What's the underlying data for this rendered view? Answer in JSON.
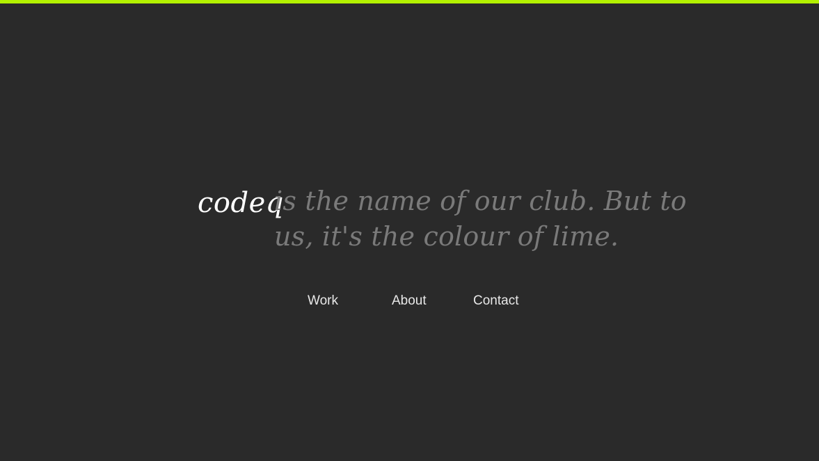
{
  "colors": {
    "background": "#2a2a2a",
    "accent_bar": "#b3f000",
    "brand_text": "#ffffff",
    "tagline_text": "#7a7a7a",
    "nav_text": "#e8e8e8"
  },
  "hero": {
    "brand": "codeq",
    "tagline": "is the name of our club. But to us, it's the colour of lime."
  },
  "nav": {
    "items": [
      {
        "label": "Work"
      },
      {
        "label": "About"
      },
      {
        "label": "Contact"
      }
    ]
  }
}
